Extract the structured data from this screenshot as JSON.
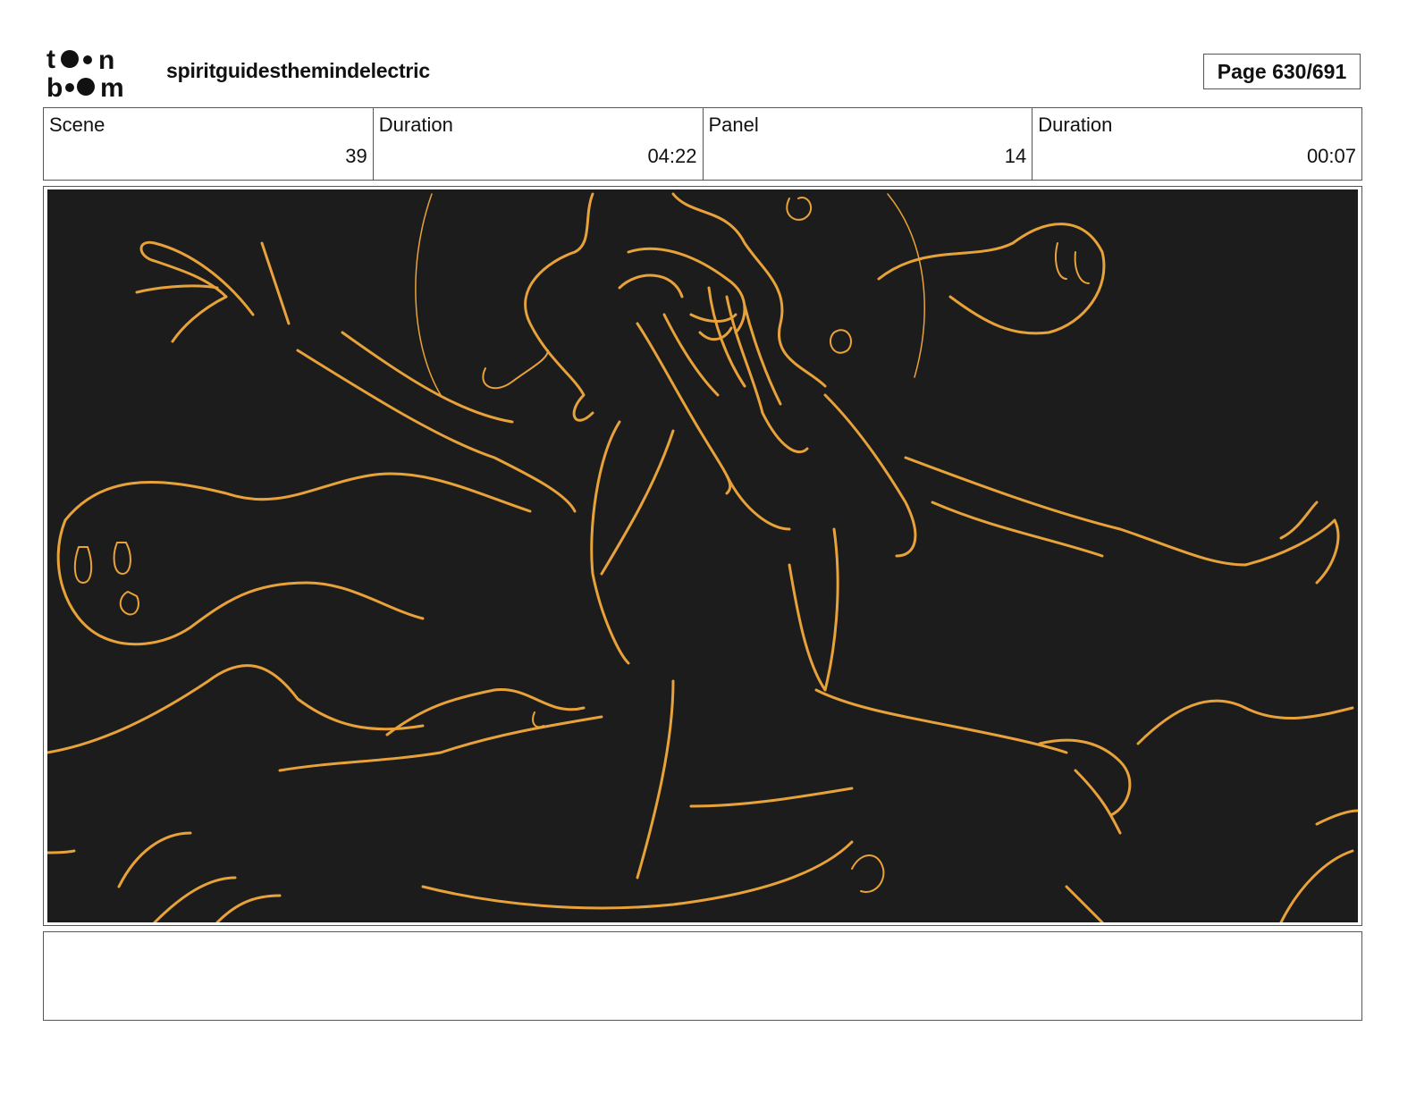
{
  "header": {
    "logo_text": "toon boom",
    "project_title": "spiritguidesthemindelectric",
    "page_label": "Page 630/691"
  },
  "info": {
    "scene_label": "Scene",
    "scene_value": "39",
    "scene_duration_label": "Duration",
    "scene_duration_value": "04:22",
    "panel_label": "Panel",
    "panel_value": "14",
    "panel_duration_label": "Duration",
    "panel_duration_value": "00:07"
  },
  "panel": {
    "sketch_line_color": "#e8a23a",
    "background_color": "#1c1c1c"
  },
  "notes": {
    "text": ""
  }
}
